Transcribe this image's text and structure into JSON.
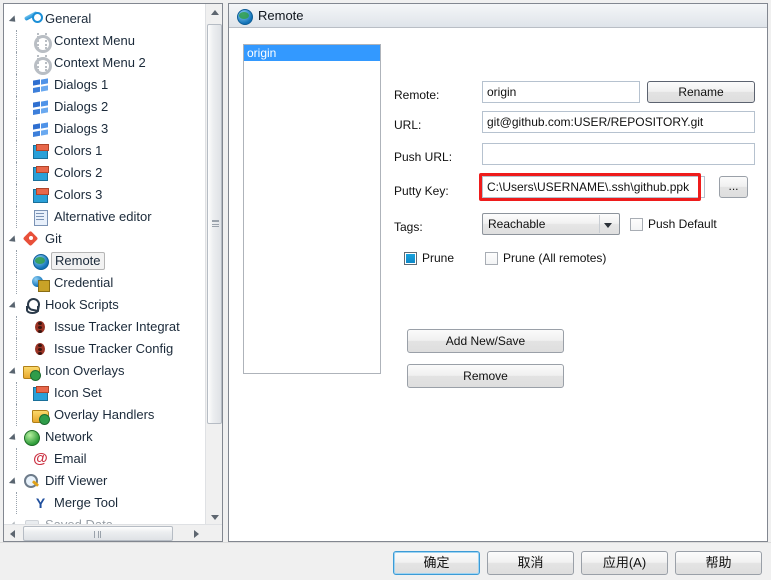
{
  "dialog": {
    "background": "#f0f0f0"
  },
  "sidebar": {
    "items": [
      {
        "label": "General",
        "icon": "wrench-icon",
        "level": 0,
        "expander": true,
        "selected": false
      },
      {
        "label": "Context Menu",
        "icon": "gear-icon",
        "level": 1,
        "expander": false,
        "selected": false
      },
      {
        "label": "Context Menu 2",
        "icon": "gear-icon",
        "level": 1,
        "expander": false,
        "selected": false
      },
      {
        "label": "Dialogs 1",
        "icon": "windows-icon",
        "level": 1,
        "expander": false,
        "selected": false
      },
      {
        "label": "Dialogs 2",
        "icon": "windows-icon",
        "level": 1,
        "expander": false,
        "selected": false
      },
      {
        "label": "Dialogs 3",
        "icon": "windows-icon",
        "level": 1,
        "expander": false,
        "selected": false
      },
      {
        "label": "Colors 1",
        "icon": "colors-icon",
        "level": 1,
        "expander": false,
        "selected": false
      },
      {
        "label": "Colors 2",
        "icon": "colors-icon",
        "level": 1,
        "expander": false,
        "selected": false
      },
      {
        "label": "Colors 3",
        "icon": "colors-icon",
        "level": 1,
        "expander": false,
        "selected": false
      },
      {
        "label": "Alternative editor",
        "icon": "note-icon",
        "level": 1,
        "expander": false,
        "selected": false
      },
      {
        "label": "Git",
        "icon": "git-icon",
        "level": 0,
        "expander": true,
        "selected": false
      },
      {
        "label": "Remote",
        "icon": "globe-icon",
        "level": 1,
        "expander": false,
        "selected": true
      },
      {
        "label": "Credential",
        "icon": "credential-icon",
        "level": 1,
        "expander": false,
        "selected": false
      },
      {
        "label": "Hook Scripts",
        "icon": "hook-icon",
        "level": 0,
        "expander": true,
        "selected": false
      },
      {
        "label": "Issue Tracker Integrat",
        "icon": "bug-icon",
        "level": 1,
        "expander": false,
        "selected": false
      },
      {
        "label": "Issue Tracker Config",
        "icon": "bug-icon",
        "level": 1,
        "expander": false,
        "selected": false
      },
      {
        "label": "Icon Overlays",
        "icon": "folder-icon",
        "level": 0,
        "expander": true,
        "selected": false
      },
      {
        "label": "Icon Set",
        "icon": "iconset-icon",
        "level": 1,
        "expander": false,
        "selected": false
      },
      {
        "label": "Overlay Handlers",
        "icon": "folder-icon",
        "level": 1,
        "expander": false,
        "selected": false
      },
      {
        "label": "Network",
        "icon": "greenball-icon",
        "level": 0,
        "expander": true,
        "selected": false
      },
      {
        "label": "Email",
        "icon": "at-icon",
        "level": 1,
        "expander": false,
        "selected": false
      },
      {
        "label": "Diff Viewer",
        "icon": "diff-icon",
        "level": 0,
        "expander": true,
        "selected": false
      },
      {
        "label": "Merge Tool",
        "icon": "merge-icon",
        "level": 1,
        "expander": false,
        "selected": false
      },
      {
        "label": "Saved Data",
        "icon": "save-icon",
        "level": 0,
        "expander": true,
        "selected": false
      }
    ]
  },
  "panel": {
    "title": "Remote",
    "title_icon": "globe-icon",
    "remote_list_label": "Remote:",
    "remote_list": {
      "options": [
        "origin"
      ],
      "selected": "origin"
    },
    "fields": {
      "remote_label": "Remote:",
      "remote_value": "origin",
      "rename_button": "Rename",
      "url_label": "URL:",
      "url_value": "git@github.com:USER/REPOSITORY.git",
      "push_url_label": "Push URL:",
      "push_url_value": "",
      "push_url_placeholder": "",
      "putty_key_label": "Putty Key:",
      "putty_key_value": "C:\\Users\\USERNAME\\.ssh\\github.ppk",
      "browse_button": "...",
      "tags_label": "Tags:",
      "tags_value": "Reachable",
      "tags_options": [
        "Reachable"
      ],
      "push_default_label": "Push Default",
      "push_default_checked": false,
      "prune_label": "Prune",
      "prune_checked": true,
      "prune_all_label": "Prune (All remotes)",
      "prune_all_checked": false
    },
    "actions": {
      "add_new_save": "Add New/Save",
      "remove": "Remove"
    },
    "highlight_color": "#ee1c1c"
  },
  "footer": {
    "ok": "确定",
    "cancel": "取消",
    "apply": "应用(A)",
    "help": "帮助"
  }
}
